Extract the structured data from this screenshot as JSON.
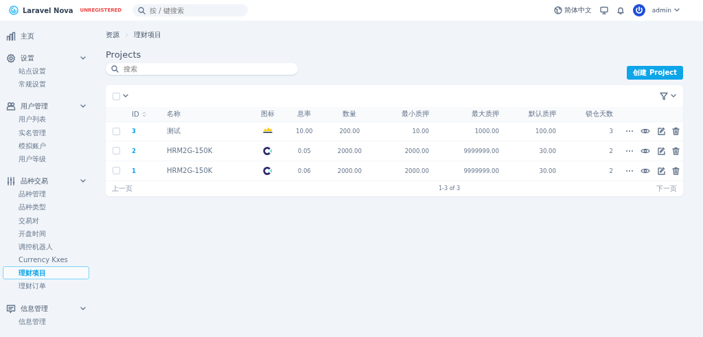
{
  "header": {
    "brand": "Laravel Nova",
    "license": "UNREGISTERED",
    "search": {
      "placeholder": "按 / 键搜索"
    },
    "language": "简体中文",
    "user": "admin"
  },
  "sidebar": {
    "groups": [
      {
        "kind": "chart",
        "title": "主页",
        "expandable": false
      },
      {
        "kind": "gear",
        "title": "设置",
        "expandable": true,
        "items": [
          {
            "label": "站点设置",
            "selected": false
          },
          {
            "label": "常规设置",
            "selected": false
          }
        ]
      },
      {
        "kind": "users",
        "title": "用户管理",
        "expandable": true,
        "items": [
          {
            "label": "用户列表",
            "selected": false
          },
          {
            "label": "实名管理",
            "selected": false
          },
          {
            "label": "模拟账户",
            "selected": false
          },
          {
            "label": "用户等级",
            "selected": false
          }
        ]
      },
      {
        "kind": "sliders",
        "title": "品种交易",
        "expandable": true,
        "items": [
          {
            "label": "品种管理",
            "selected": false
          },
          {
            "label": "品种类型",
            "selected": false
          },
          {
            "label": "交易对",
            "selected": false
          },
          {
            "label": "开盘时间",
            "selected": false
          },
          {
            "label": "调控机器人",
            "selected": false
          },
          {
            "label": "Currency Kxes",
            "selected": false
          },
          {
            "label": "理财项目",
            "selected": true
          },
          {
            "label": "理财订单",
            "selected": false
          }
        ]
      },
      {
        "kind": "message",
        "title": "信息管理",
        "expandable": true,
        "items": [
          {
            "label": "信息管理",
            "selected": false
          }
        ]
      }
    ]
  },
  "breadcrumb": [
    "资源",
    "理财项目"
  ],
  "page": {
    "title": "Projects",
    "search": {
      "placeholder": "搜索"
    },
    "create_button": "创建 Project"
  },
  "table": {
    "select_all_checked": false,
    "columns": [
      "ID",
      "名称",
      "图标",
      "息率",
      "数量",
      "最小质押",
      "最大质押",
      "默认质押",
      "锁仓天数"
    ],
    "rows": [
      {
        "id": "3",
        "name": "测试",
        "kind": "crown",
        "rate": "10.00",
        "amount": "200.00",
        "min": "10.00",
        "max": "1000.00",
        "default": "100.00",
        "days": "3",
        "checked": false
      },
      {
        "id": "2",
        "name": "HRM2G-150K",
        "kind": "ring",
        "rate": "0.05",
        "amount": "2000.00",
        "min": "2000.00",
        "max": "9999999.00",
        "default": "30.00",
        "days": "2",
        "checked": false
      },
      {
        "id": "1",
        "name": "HRM2G-150K",
        "kind": "ring",
        "rate": "0.06",
        "amount": "2000.00",
        "min": "2000.00",
        "max": "9999999.00",
        "default": "30.00",
        "days": "2",
        "checked": false
      }
    ],
    "pagination": {
      "previous": "上一页",
      "range": "1-3 of 3",
      "next": "下一页"
    }
  }
}
